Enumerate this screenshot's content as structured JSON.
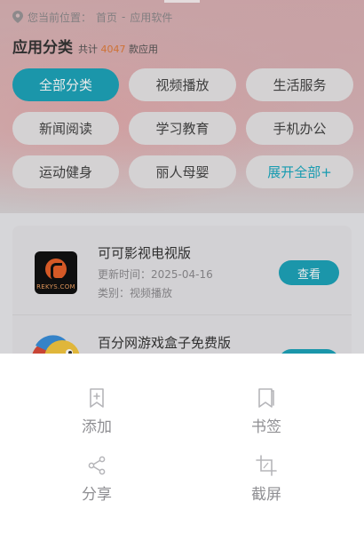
{
  "breadcrumb": {
    "prefix": "您当前位置：",
    "home": "首页",
    "separator": "-",
    "current": "应用软件"
  },
  "header": {
    "title": "应用分类",
    "count_prefix": "共计",
    "count": "4047",
    "count_suffix": "款应用"
  },
  "categories": [
    {
      "label": "全部分类",
      "active": true
    },
    {
      "label": "视频播放"
    },
    {
      "label": "生活服务"
    },
    {
      "label": "新闻阅读"
    },
    {
      "label": "学习教育"
    },
    {
      "label": "手机办公"
    },
    {
      "label": "运动健身"
    },
    {
      "label": "丽人母婴"
    },
    {
      "label": "展开全部+"
    }
  ],
  "apps": [
    {
      "name": "可可影视电视版",
      "update_label": "更新时间：",
      "update": "2025-04-16",
      "category_label": "类别：",
      "category": "视频播放",
      "button": "查看",
      "icon_brand": "REKYS.COM"
    },
    {
      "name": "百分网游戏盒子免费版",
      "button": "查看"
    }
  ],
  "share_sheet": {
    "items": [
      {
        "label": "添加",
        "icon": "add-bookmark-icon"
      },
      {
        "label": "书签",
        "icon": "bookmark-icon"
      },
      {
        "label": "分享",
        "icon": "share-icon"
      },
      {
        "label": "截屏",
        "icon": "crop-icon"
      }
    ]
  },
  "colors": {
    "accent": "#1ea3b9",
    "count": "#e07c3a"
  }
}
